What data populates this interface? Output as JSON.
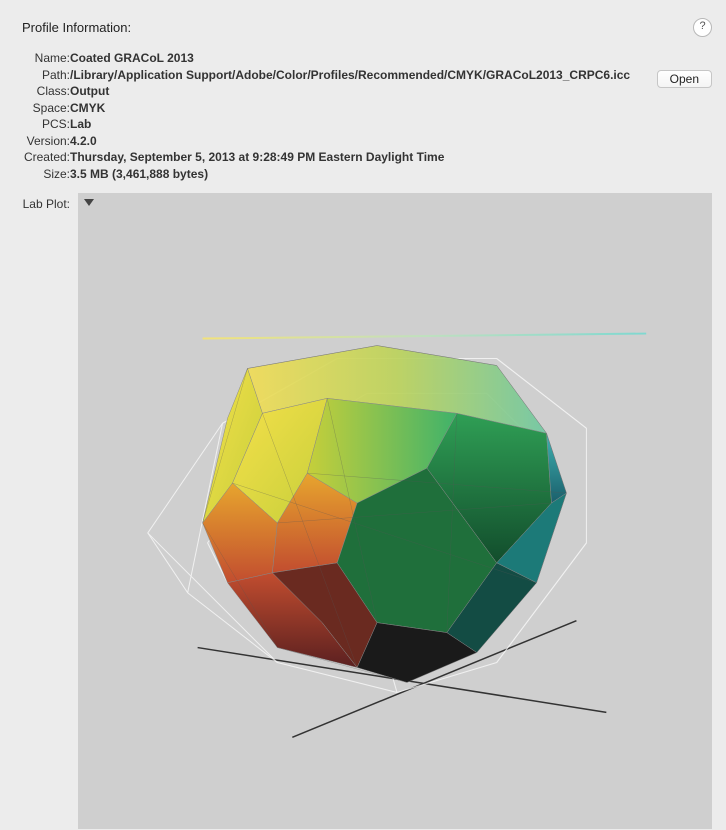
{
  "title": "Profile Information:",
  "help_tooltip": "?",
  "open_label": "Open",
  "labels": {
    "name": "Name:",
    "path": "Path:",
    "class": "Class:",
    "space": "Space:",
    "pcs": "PCS:",
    "version": "Version:",
    "created": "Created:",
    "size": "Size:",
    "lab_plot": "Lab Plot:"
  },
  "values": {
    "name": "Coated GRACoL 2013",
    "path": "/Library/Application Support/Adobe/Color/Profiles/Recommended/CMYK/GRACoL2013_CRPC6.icc",
    "class": "Output",
    "space": "CMYK",
    "pcs": "Lab",
    "version": "4.2.0",
    "created": "Thursday, September 5, 2013 at 9:28:49 PM Eastern Daylight Time",
    "size": "3.5 MB (3,461,888 bytes)"
  }
}
